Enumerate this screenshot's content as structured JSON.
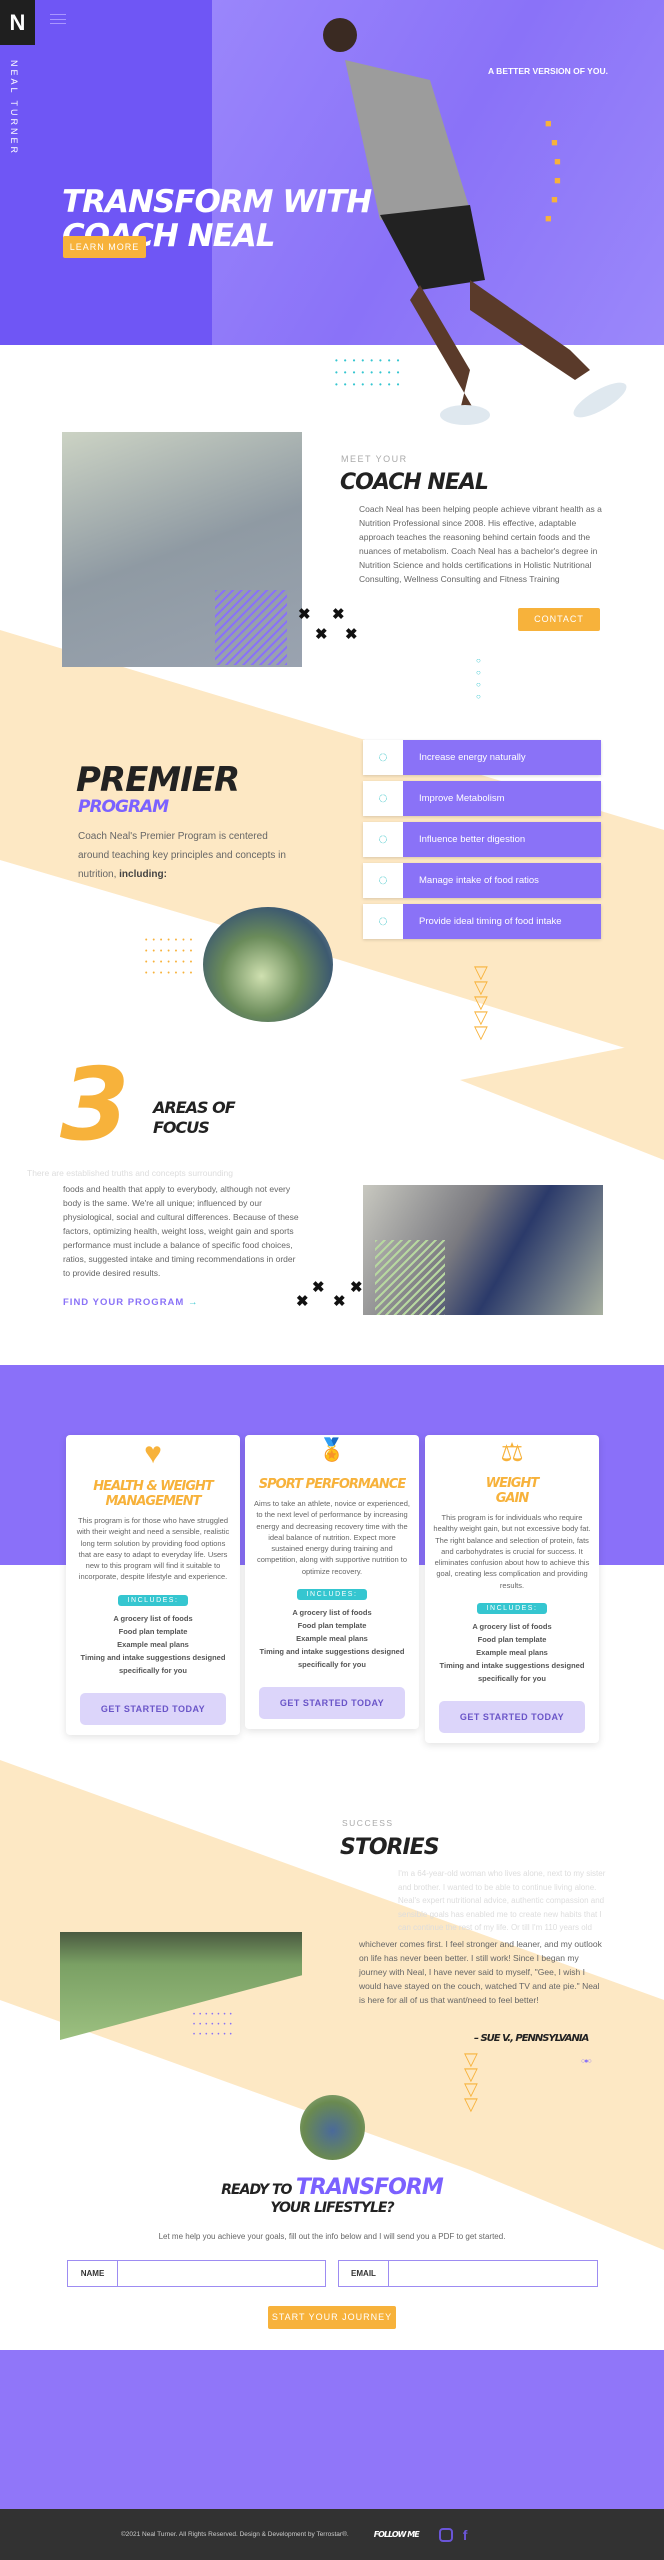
{
  "colors": {
    "purple": "#7b61ff",
    "orange": "#f7b23b",
    "peach": "#fde8c4",
    "teal": "#35c6d0",
    "footer": "#323232"
  },
  "brand": {
    "logo": "N",
    "vertical_name": "NEAL TURNER",
    "menu_icon": "hamburger-icon"
  },
  "hero": {
    "tagline": "A BETTER VERSION OF YOU.",
    "title_line1": "TRANSFORM WITH",
    "title_line2": "COACH NEAL",
    "button": "LEARN MORE"
  },
  "about": {
    "eyebrow": "MEET YOUR",
    "title": "COACH NEAL",
    "body": "Coach Neal has been helping people achieve vibrant health as a Nutrition Professional since 2008. His effective, adaptable approach teaches the reasoning behind certain foods and the nuances of metabolism. Coach Neal has a bachelor's degree in Nutrition Science and holds certifications in Holistic Nutritional Consulting, Wellness Consulting and Fitness Training",
    "button": "CONTACT"
  },
  "premier": {
    "title": "PREMIER",
    "subtitle": "PROGRAM",
    "body": "Coach Neal's Premier Program is centered around teaching key principles and concepts in nutrition,",
    "body_bold": "including:",
    "items": [
      {
        "label": "Increase energy naturally"
      },
      {
        "label": "Improve Metabolism"
      },
      {
        "label": "Influence better digestion"
      },
      {
        "label": "Manage intake of food ratios"
      },
      {
        "label": "Provide ideal timing of food intake"
      }
    ]
  },
  "areas": {
    "number": "3",
    "title_line1": "AREAS OF",
    "title_line2": "FOCUS",
    "body_faded": "There are established truths and concepts surrounding",
    "body": "foods and health that apply to everybody, although not every body is the same. We're all unique; influenced by our physiological, social and cultural differences. Because of these factors, optimizing health, weight loss, weight gain and sports performance must include a balance of specific food choices, ratios, suggested intake and timing recommendations in order to provide desired results.",
    "link": "FIND YOUR PROGRAM",
    "link_arrow": "→"
  },
  "programs": [
    {
      "icon": "heart-rate-icon",
      "title": "HEALTH & WEIGHT MANAGEMENT",
      "description": "This program is for those who have struggled with their weight and need a sensible, realistic long term solution by providing food options that are easy to adapt to everyday life. Users new to this program will find it suitable to incorporate, despite lifestyle and experience.",
      "includes_label": "INCLUDES:",
      "includes": [
        "A grocery list of foods",
        "Food plan template",
        "Example meal plans",
        "Timing and intake suggestions designed specifically for you"
      ],
      "button": "GET STARTED TODAY"
    },
    {
      "icon": "medal-icon",
      "title": "SPORT PERFORMANCE",
      "description": "Aims to take an athlete, novice or experienced, to the next level of performance by increasing energy and decreasing recovery time with the ideal balance of nutrition. Expect more sustained energy during training and competition, along with supportive nutrition to optimize recovery.",
      "includes_label": "INCLUDES:",
      "includes": [
        "A grocery list of foods",
        "Food plan template",
        "Example meal plans",
        "Timing and intake suggestions designed specifically for you"
      ],
      "button": "GET STARTED TODAY"
    },
    {
      "icon": "scale-tape-icon",
      "title": "WEIGHT GAIN",
      "description": "This program is for individuals who require healthy weight gain, but not excessive body fat. The right balance and selection of protein, fats and carbohydrates is crucial for success. It eliminates confusion about how to achieve this goal, creating less complication and providing results.",
      "includes_label": "INCLUDES:",
      "includes": [
        "A grocery list of foods",
        "Food plan template",
        "Example meal plans",
        "Timing and intake suggestions designed specifically for you"
      ],
      "button": "GET STARTED TODAY"
    }
  ],
  "stories": {
    "eyebrow": "SUCCESS",
    "title": "STORIES",
    "quote_faded": "I'm a 64-year-old woman who lives alone, next to my sister and brother. I wanted to be able to continue living alone. Neal's expert nutritional advice, authentic compassion and sensible goals has enabled me to create new habits that I can continue the rest of my life. Or till I'm 110 years old",
    "quote": "whichever comes first. I feel stronger and leaner, and my outlook on life has never been better. I still work! Since I began my journey with Neal, I have never said to myself, \"Gee, I wish I would have stayed on the couch, watched TV and ate pie.\" Neal is here for all of us that want/need to feel better!",
    "author": "– SUE V., PENNSYLVANIA",
    "slide_count": 3,
    "active_slide": 2
  },
  "cta": {
    "title_a": "READY TO",
    "title_b": "TRANSFORM",
    "title_c": "YOUR LIFESTYLE?",
    "subtitle": "Let me help you achieve your goals, fill out the info below and I will send you a PDF to get started.",
    "name_label": "NAME",
    "email_label": "EMAIL",
    "name_value": "",
    "email_value": "",
    "button": "START YOUR JOURNEY"
  },
  "footer": {
    "copyright": "©2021 Neal Turner. All Rights Reserved. Design & Development by Terrostar®.",
    "follow": "FOLLOW ME",
    "social": [
      "instagram-icon",
      "facebook-icon"
    ]
  }
}
